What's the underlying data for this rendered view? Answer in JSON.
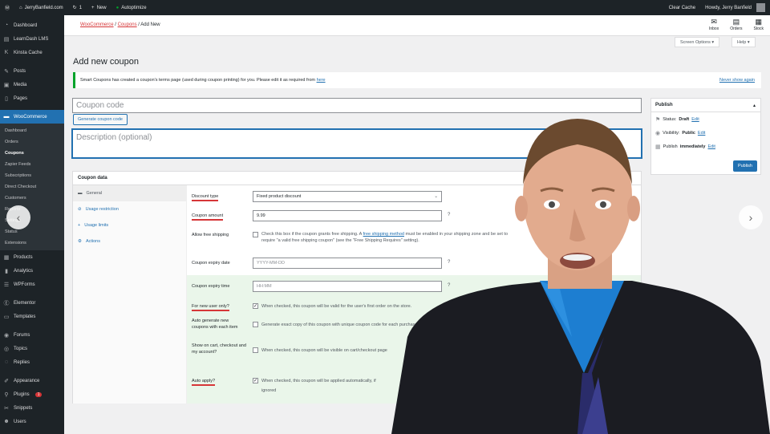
{
  "adminbar": {
    "site": "JerryBanfield.com",
    "updates": "1",
    "new_label": "New",
    "autoptimize": "Autoptimize",
    "clear_cache": "Clear Cache",
    "howdy": "Howdy, Jerry Banfield"
  },
  "sidebar": {
    "items": [
      {
        "label": "Dashboard",
        "icon": "gauge-icon"
      },
      {
        "label": "LearnDash LMS",
        "icon": "learndash-icon"
      },
      {
        "label": "Kinsta Cache",
        "icon": "kinsta-icon"
      },
      {
        "label": "Posts",
        "icon": "pin-icon"
      },
      {
        "label": "Media",
        "icon": "media-icon"
      },
      {
        "label": "Pages",
        "icon": "page-icon"
      },
      {
        "label": "WooCommerce",
        "icon": "woo-icon"
      }
    ],
    "woo_sub": [
      "Dashboard",
      "Orders",
      "Coupons",
      "Zapier Feeds",
      "Subscriptions",
      "Direct Checkout",
      "Customers",
      "Reports",
      "Settings",
      "Status",
      "Extensions"
    ],
    "items2": [
      {
        "label": "Products",
        "icon": "box-icon"
      },
      {
        "label": "Analytics",
        "icon": "chart-icon"
      },
      {
        "label": "WPForms",
        "icon": "form-icon"
      },
      {
        "label": "Elementor",
        "icon": "elementor-icon"
      },
      {
        "label": "Templates",
        "icon": "folder-icon"
      },
      {
        "label": "Forums",
        "icon": "forum-icon"
      },
      {
        "label": "Topics",
        "icon": "topic-icon"
      },
      {
        "label": "Replies",
        "icon": "reply-icon"
      },
      {
        "label": "Appearance",
        "icon": "brush-icon"
      },
      {
        "label": "Plugins",
        "icon": "plug-icon",
        "badge": "1"
      },
      {
        "label": "Snippets",
        "icon": "snippet-icon"
      },
      {
        "label": "Users",
        "icon": "user-icon"
      }
    ]
  },
  "breadcrumb": {
    "woo": "WooCommerce",
    "coupons": "Coupons",
    "current": "Add New"
  },
  "toolbar": {
    "inbox": "Inbox",
    "orders": "Orders",
    "stock": "Stock"
  },
  "screen_options": "Screen Options ▾",
  "help": "Help ▾",
  "page_title": "Add new coupon",
  "notice": {
    "text": "Smart Coupons has created a coupon's terms page (used during coupon printing) for you. Please edit it as required from",
    "link": "here",
    "dismiss": "Never show again"
  },
  "coupon_code_placeholder": "Coupon code",
  "generate_label": "Generate coupon code",
  "description_placeholder": "Description (optional)",
  "publish": {
    "title": "Publish",
    "status_label": "Status:",
    "status": "Draft",
    "visibility_label": "Visibility:",
    "visibility": "Public",
    "publish_label": "Publish",
    "publish_when": "immediately",
    "edit": "Edit",
    "button": "Publish"
  },
  "coupon_data": {
    "title": "Coupon data",
    "tabs": [
      "General",
      "Usage restriction",
      "Usage limits",
      "Actions"
    ],
    "fields": {
      "discount_type": {
        "label": "Discount type",
        "value": "Fixed product discount"
      },
      "coupon_amount": {
        "label": "Coupon amount",
        "value": "9.99"
      },
      "free_shipping": {
        "label": "Allow free shipping",
        "text_a": "Check this box if the coupon grants free shipping. A",
        "link": "free shipping method",
        "text_b": "must be enabled in your shipping zone and be set to require \"a valid free shipping coupon\" (see the \"Free Shipping Requires\" setting)."
      },
      "expiry_date": {
        "label": "Coupon expiry date",
        "placeholder": "YYYY-MM-DD"
      },
      "expiry_time": {
        "label": "Coupon expiry time",
        "placeholder": "HH:MM"
      },
      "new_user": {
        "label": "For new user only?",
        "text": "When checked, this coupon will be valid for the user's first order on the store."
      },
      "auto_generate": {
        "label": "Auto generate new coupons with each item",
        "text": "Generate exact copy of this coupon with unique coupon code for each purchased product"
      },
      "show_cart": {
        "label": "Show on cart, checkout and my account?",
        "text": "When checked, this coupon will be visible on cart/checkout page"
      },
      "auto_apply": {
        "label": "Auto apply?",
        "text": "When checked, this coupon will be applied automatically, if",
        "text2": "ignored"
      }
    }
  }
}
